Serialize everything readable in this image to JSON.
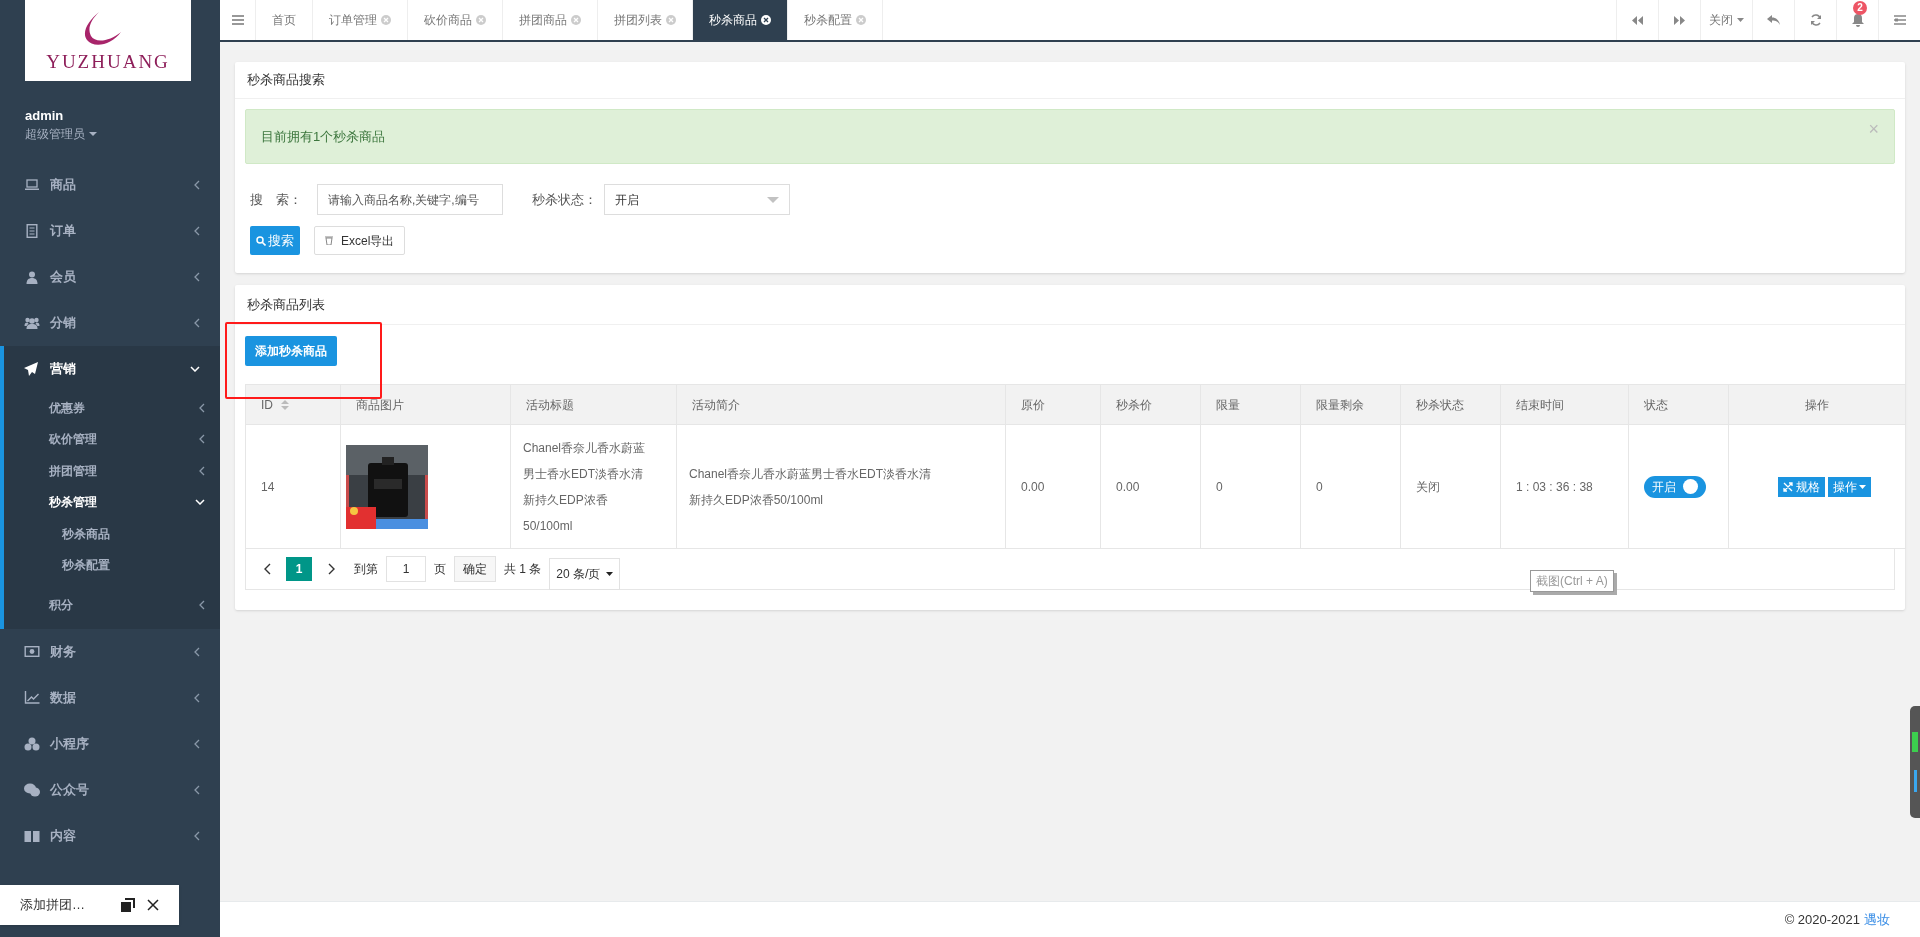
{
  "sidebar": {
    "logo_text": "YUZHUANG",
    "user": {
      "name": "admin",
      "role": "超级管理员"
    },
    "items": [
      {
        "label": "商品",
        "expanded": false
      },
      {
        "label": "订单",
        "expanded": false
      },
      {
        "label": "会员",
        "expanded": false
      },
      {
        "label": "分销",
        "expanded": false
      },
      {
        "label": "营销",
        "expanded": true,
        "children": [
          {
            "label": "优惠券",
            "expanded": false
          },
          {
            "label": "砍价管理",
            "expanded": false
          },
          {
            "label": "拼团管理",
            "expanded": false
          },
          {
            "label": "秒杀管理",
            "expanded": true,
            "children": [
              {
                "label": "秒杀商品"
              },
              {
                "label": "秒杀配置"
              }
            ]
          },
          {
            "label": "积分",
            "expanded": false
          }
        ]
      },
      {
        "label": "财务",
        "expanded": false
      },
      {
        "label": "数据",
        "expanded": false
      },
      {
        "label": "小程序",
        "expanded": false
      },
      {
        "label": "公众号",
        "expanded": false
      },
      {
        "label": "内容",
        "expanded": false
      }
    ]
  },
  "minimized_window": {
    "title": "添加拼团…"
  },
  "tabs": [
    {
      "label": "首页",
      "closable": false,
      "selected": false
    },
    {
      "label": "订单管理",
      "closable": true,
      "selected": false
    },
    {
      "label": "砍价商品",
      "closable": true,
      "selected": false
    },
    {
      "label": "拼团商品",
      "closable": true,
      "selected": false
    },
    {
      "label": "拼团列表",
      "closable": true,
      "selected": false
    },
    {
      "label": "秒杀商品",
      "closable": true,
      "selected": true
    },
    {
      "label": "秒杀配置",
      "closable": true,
      "selected": false
    }
  ],
  "toolbar": {
    "close_menu": "关闭",
    "notifications": "2"
  },
  "search_panel": {
    "title": "秒杀商品搜索",
    "alert": "目前拥有1个秒杀商品",
    "alert_close": "×",
    "search_label": "搜　索：",
    "search_placeholder": "请输入商品名称,关键字,编号",
    "status_label": "秒杀状态：",
    "status_value": "开启",
    "search_button": "搜索",
    "export_button": "Excel导出"
  },
  "list_panel": {
    "title": "秒杀商品列表",
    "add_button": "添加秒杀商品",
    "table": {
      "columns": [
        "ID",
        "商品图片",
        "活动标题",
        "活动简介",
        "原价",
        "秒杀价",
        "限量",
        "限量剩余",
        "秒杀状态",
        "结束时间",
        "状态",
        "操作"
      ],
      "rows": [
        {
          "id": "14",
          "title": "Chanel香奈儿香水蔚蓝男士香水EDT淡香水清新持久EDP浓香50/100ml",
          "intro": "Chanel香奈儿香水蔚蓝男士香水EDT淡香水清新持久EDP浓香50/100ml",
          "price": "0.00",
          "seckill_price": "0.00",
          "limit": "0",
          "remaining": "0",
          "seckill_status": "关闭",
          "end_time": "1 : 03 : 36 : 38",
          "enabled": {
            "on": true,
            "label": "开启"
          },
          "spec_button": "规格",
          "action_button": "操作"
        }
      ]
    },
    "pagination": {
      "pages": [
        {
          "label": "1",
          "selected": true
        }
      ],
      "goto_label": "到第",
      "goto_value": "1",
      "page_unit": "页",
      "confirm": "确定",
      "total": "共 1 条",
      "page_size": "20 条/页"
    }
  },
  "screenshot_tip": "截图(Ctrl + A)",
  "footer": {
    "copyright": "© 2020-2021",
    "link": "遇妆"
  }
}
